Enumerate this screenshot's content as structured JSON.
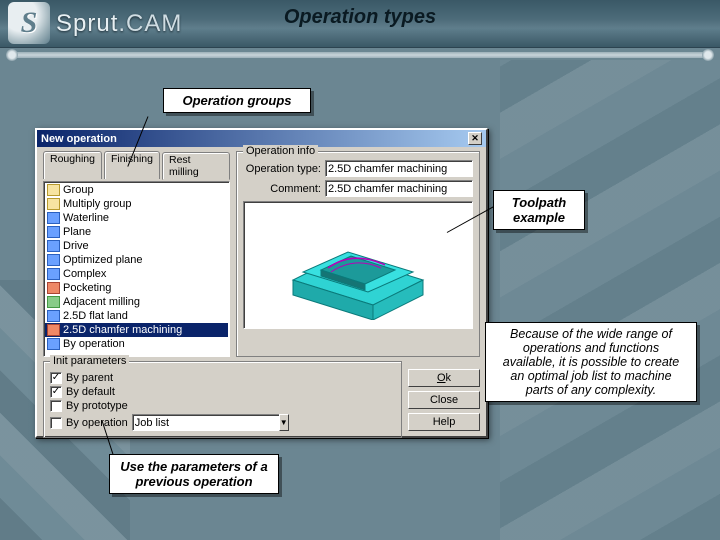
{
  "header": {
    "brand_main": "Sprut",
    "brand_dot": ".",
    "brand_sub": "CAM",
    "page_title": "Operation types"
  },
  "callouts": {
    "groups": "Operation groups",
    "toolpath": "Toolpath example",
    "params": "Use the parameters of a previous operation",
    "desc": "Because of the wide range of operations and functions available, it is possible to create an optimal job list to machine parts of any complexity."
  },
  "dialog": {
    "title": "New operation",
    "tabs": [
      "Roughing",
      "Finishing",
      "Rest milling"
    ],
    "active_tab": 2,
    "tree": [
      {
        "icon": "folder",
        "label": "Group"
      },
      {
        "icon": "folder",
        "label": "Multiply group"
      },
      {
        "icon": "blue",
        "label": "Waterline"
      },
      {
        "icon": "blue",
        "label": "Plane"
      },
      {
        "icon": "blue",
        "label": "Drive"
      },
      {
        "icon": "blue",
        "label": "Optimized plane"
      },
      {
        "icon": "blue",
        "label": "Complex"
      },
      {
        "icon": "red",
        "label": "Pocketing"
      },
      {
        "icon": "green",
        "label": "Adjacent milling"
      },
      {
        "icon": "blue",
        "label": "2.5D flat land"
      },
      {
        "icon": "red",
        "label": "2.5D chamfer machining"
      },
      {
        "icon": "blue",
        "label": "By operation"
      }
    ],
    "selected_tree_index": 10,
    "info": {
      "group_label": "Operation info",
      "type_label": "Operation type:",
      "type_value": "2.5D chamfer machining",
      "comment_label": "Comment:",
      "comment_value": "2.5D chamfer machining"
    },
    "init": {
      "group_label": "Init parameters",
      "rows": [
        {
          "checked": true,
          "label": "By parent"
        },
        {
          "checked": true,
          "label": "By default"
        },
        {
          "checked": false,
          "label": "By prototype"
        },
        {
          "checked": false,
          "label": "By operation",
          "combo": "Job list"
        }
      ]
    },
    "buttons": {
      "ok": "Ok",
      "close": "Close",
      "help": "Help"
    }
  }
}
